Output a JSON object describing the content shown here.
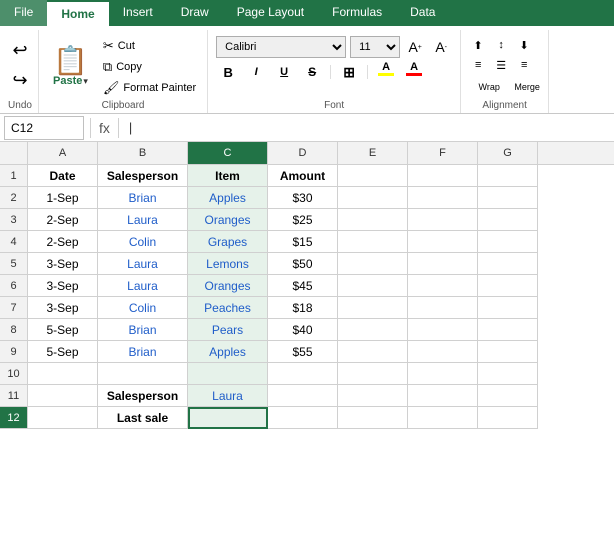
{
  "tabs": [
    {
      "label": "File",
      "active": false
    },
    {
      "label": "Home",
      "active": true
    },
    {
      "label": "Insert",
      "active": false
    },
    {
      "label": "Draw",
      "active": false
    },
    {
      "label": "Page Layout",
      "active": false
    },
    {
      "label": "Formulas",
      "active": false
    },
    {
      "label": "Data",
      "active": false
    }
  ],
  "ribbon": {
    "clipboard": {
      "label": "Clipboard",
      "paste": "Paste",
      "cut": "Cut",
      "copy": "Copy",
      "format_painter": "Format Painter"
    },
    "font": {
      "label": "Font",
      "font_name": "Calibri",
      "font_size": "11",
      "bold": "B",
      "italic": "I",
      "underline": "U",
      "strikethrough": "S",
      "border": "⊞",
      "highlight": "A",
      "fontcolor": "A"
    },
    "undo_label": "Undo"
  },
  "formula_bar": {
    "name_box": "C12",
    "fx": "fx",
    "formula": ""
  },
  "columns": [
    "A",
    "B",
    "C",
    "D",
    "E",
    "F",
    "G"
  ],
  "rows": [
    "1",
    "2",
    "3",
    "4",
    "5",
    "6",
    "7",
    "8",
    "9",
    "10",
    "11",
    "12"
  ],
  "cells": {
    "A1": {
      "value": "Date",
      "bold": true,
      "align": "center"
    },
    "B1": {
      "value": "Salesperson",
      "bold": true,
      "align": "center"
    },
    "C1": {
      "value": "Item",
      "bold": true,
      "align": "center"
    },
    "D1": {
      "value": "Amount",
      "bold": true,
      "align": "center"
    },
    "A2": {
      "value": "1-Sep",
      "align": "center"
    },
    "B2": {
      "value": "Brian",
      "align": "center",
      "blue": true
    },
    "C2": {
      "value": "Apples",
      "align": "center",
      "blue": true
    },
    "D2": {
      "value": "$30",
      "align": "center"
    },
    "A3": {
      "value": "2-Sep",
      "align": "center"
    },
    "B3": {
      "value": "Laura",
      "align": "center",
      "blue": true
    },
    "C3": {
      "value": "Oranges",
      "align": "center",
      "blue": true
    },
    "D3": {
      "value": "$25",
      "align": "center"
    },
    "A4": {
      "value": "2-Sep",
      "align": "center"
    },
    "B4": {
      "value": "Colin",
      "align": "center",
      "blue": true
    },
    "C4": {
      "value": "Grapes",
      "align": "center",
      "blue": true
    },
    "D4": {
      "value": "$15",
      "align": "center"
    },
    "A5": {
      "value": "3-Sep",
      "align": "center"
    },
    "B5": {
      "value": "Laura",
      "align": "center",
      "blue": true
    },
    "C5": {
      "value": "Lemons",
      "align": "center",
      "blue": true
    },
    "D5": {
      "value": "$50",
      "align": "center"
    },
    "A6": {
      "value": "3-Sep",
      "align": "center"
    },
    "B6": {
      "value": "Laura",
      "align": "center",
      "blue": true
    },
    "C6": {
      "value": "Oranges",
      "align": "center",
      "blue": true
    },
    "D6": {
      "value": "$45",
      "align": "center"
    },
    "A7": {
      "value": "3-Sep",
      "align": "center"
    },
    "B7": {
      "value": "Colin",
      "align": "center",
      "blue": true
    },
    "C7": {
      "value": "Peaches",
      "align": "center",
      "blue": true
    },
    "D7": {
      "value": "$18",
      "align": "center"
    },
    "A8": {
      "value": "5-Sep",
      "align": "center"
    },
    "B8": {
      "value": "Brian",
      "align": "center",
      "blue": true
    },
    "C8": {
      "value": "Pears",
      "align": "center",
      "blue": true
    },
    "D8": {
      "value": "$40",
      "align": "center"
    },
    "A9": {
      "value": "5-Sep",
      "align": "center"
    },
    "B9": {
      "value": "Brian",
      "align": "center",
      "blue": true
    },
    "C9": {
      "value": "Apples",
      "align": "center",
      "blue": true
    },
    "D9": {
      "value": "$55",
      "align": "center"
    },
    "A11": {
      "value": "",
      "align": "center"
    },
    "B11": {
      "value": "Salesperson",
      "bold": true,
      "align": "center"
    },
    "C11": {
      "value": "Laura",
      "align": "center",
      "blue": true
    },
    "A12": {
      "value": "",
      "align": "center"
    },
    "B12": {
      "value": "Last sale",
      "bold": true,
      "align": "center"
    },
    "C12": {
      "value": "",
      "align": "center",
      "active": true
    }
  },
  "active_cell": "C12",
  "selected_col": "C"
}
